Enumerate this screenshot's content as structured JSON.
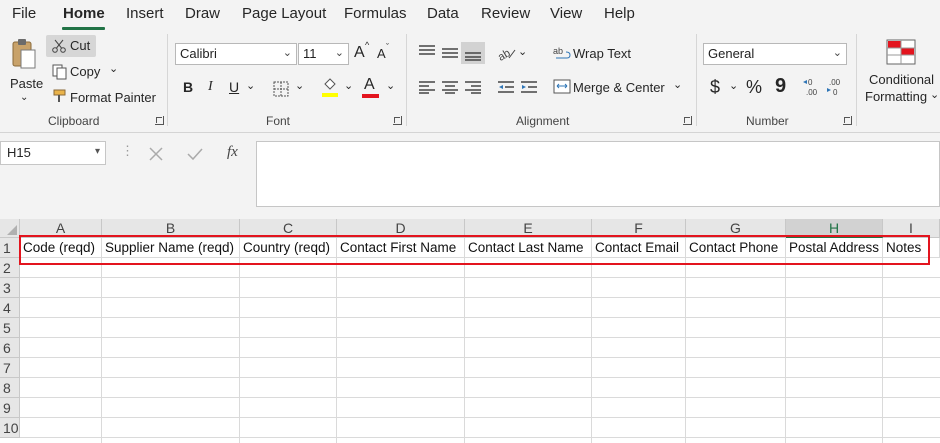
{
  "menu": {
    "items": [
      {
        "label": "File"
      },
      {
        "label": "Home",
        "active": true
      },
      {
        "label": "Insert"
      },
      {
        "label": "Draw"
      },
      {
        "label": "Page Layout"
      },
      {
        "label": "Formulas"
      },
      {
        "label": "Data"
      },
      {
        "label": "Review"
      },
      {
        "label": "View"
      },
      {
        "label": "Help"
      }
    ]
  },
  "ribbon": {
    "clipboard": {
      "paste": "Paste",
      "cut": "Cut",
      "copy": "Copy",
      "format_painter": "Format Painter",
      "group_label": "Clipboard"
    },
    "font": {
      "font_name": "Calibri",
      "font_size": "11",
      "bold": "B",
      "italic": "I",
      "underline": "U",
      "grow": "A",
      "shrink": "A",
      "font_color_letter": "A",
      "group_label": "Font"
    },
    "alignment": {
      "wrap_text": "Wrap Text",
      "merge_center": "Merge & Center",
      "group_label": "Alignment"
    },
    "number": {
      "format": "General",
      "currency": "$",
      "percent": "%",
      "comma": "9",
      "group_label": "Number"
    },
    "styles": {
      "conditional_line1": "Conditional",
      "conditional_line2": "Formatting"
    }
  },
  "formula_bar": {
    "name_box": "H15",
    "fx": "fx",
    "content": ""
  },
  "grid": {
    "columns": [
      "A",
      "B",
      "C",
      "D",
      "E",
      "F",
      "G",
      "H",
      "I"
    ],
    "selected_column": "H",
    "rows": [
      "1",
      "2",
      "3",
      "4",
      "5",
      "6",
      "7",
      "8",
      "9",
      "10"
    ],
    "headers_row1": [
      "Code (reqd)",
      "Supplier Name (reqd)",
      "Country (reqd)",
      "Contact First Name",
      "Contact Last Name",
      "Contact Email",
      "Contact Phone",
      "Postal Address",
      "Notes"
    ]
  },
  "colors": {
    "accent": "#217346",
    "highlight_box": "#e3141e",
    "font_color_bar": "#e3141e",
    "fill_color_bar": "#ffff00"
  }
}
